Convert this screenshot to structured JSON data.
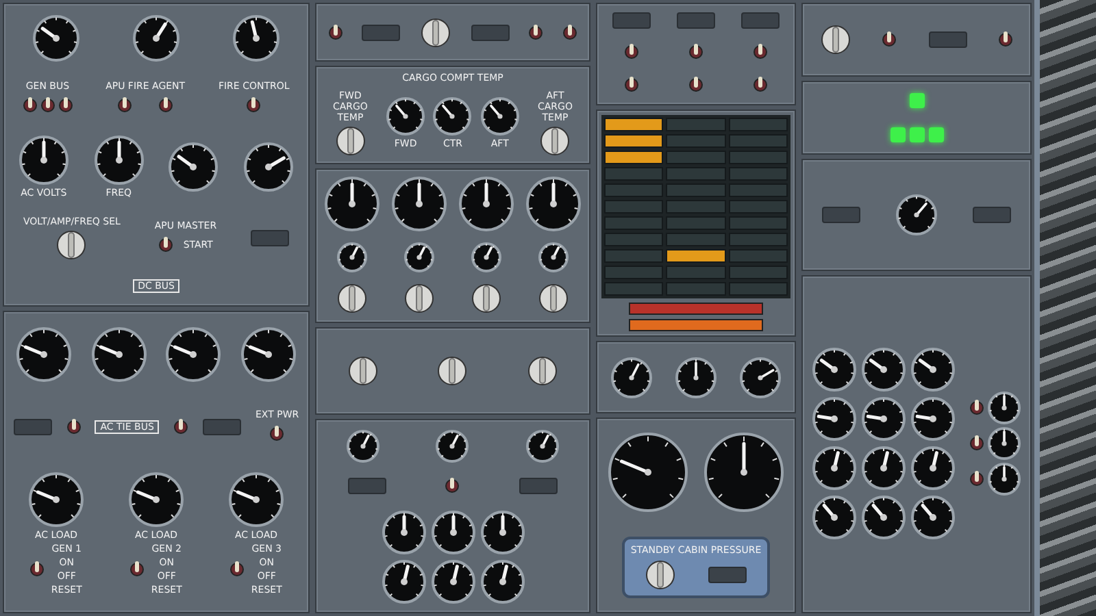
{
  "left_upper": {
    "top_gauges": [
      {
        "level": 0.3
      },
      {
        "level": 0.62
      },
      {
        "level": 0.45
      }
    ],
    "gen_bus": "GEN BUS",
    "apu_fire": "APU FIRE AGENT",
    "fire_control": "FIRE CONTROL",
    "meters": [
      {
        "label": "AC VOLTS",
        "level": 0.5
      },
      {
        "label": "FREQ",
        "level": 0.5
      },
      {
        "level": 0.3
      },
      {
        "level": 0.72
      }
    ],
    "selector": "VOLT/AMP/FREQ SEL",
    "apu_master": "APU MASTER",
    "apu_start": "START",
    "bus": "DC BUS"
  },
  "left_lower": {
    "load_gauges": [
      {
        "level": 0.25
      },
      {
        "level": 0.25
      },
      {
        "level": 0.25
      },
      {
        "level": 0.25
      }
    ],
    "tie_bus": "AC TIE BUS",
    "ext_pwr": "EXT PWR",
    "generators": [
      {
        "name": "GEN 1",
        "positions": [
          "ON",
          "OFF",
          "RESET"
        ],
        "gauge": {
          "label": "AC LOAD",
          "level": 0.25
        }
      },
      {
        "name": "GEN 2",
        "positions": [
          "ON",
          "OFF",
          "RESET"
        ],
        "gauge": {
          "label": "AC LOAD",
          "level": 0.25
        }
      },
      {
        "name": "GEN 3",
        "positions": [
          "ON",
          "OFF",
          "RESET"
        ],
        "gauge": {
          "label": "AC LOAD",
          "level": 0.25
        }
      }
    ]
  },
  "middle_upper": {
    "title": "CARGO COMPT TEMP",
    "fwd_selector": "FWD CARGO TEMP",
    "aft_selector": "AFT CARGO TEMP",
    "temps": [
      {
        "label": "FWD",
        "level": 0.35
      },
      {
        "label": "CTR",
        "level": 0.35
      },
      {
        "label": "AFT",
        "level": 0.35
      }
    ],
    "big_gauges": [
      {
        "level": 0.5
      },
      {
        "level": 0.5
      },
      {
        "level": 0.5
      },
      {
        "level": 0.5
      }
    ],
    "small_gauges": [
      {
        "level": 0.6
      },
      {
        "level": 0.6
      },
      {
        "level": 0.6
      },
      {
        "level": 0.6
      }
    ]
  },
  "middle_lower": {
    "small_gauges": [
      {
        "level": 0.6
      },
      {
        "level": 0.6
      },
      {
        "level": 0.6
      }
    ],
    "engine_gauges": [
      {
        "level": 0.5
      },
      {
        "level": 0.5
      },
      {
        "level": 0.5
      },
      {
        "level": 0.55
      },
      {
        "level": 0.55
      },
      {
        "level": 0.55
      }
    ]
  },
  "annunciators": {
    "rows": [
      {
        "cells": [
          true,
          false,
          false
        ]
      },
      {
        "cells": [
          true,
          false,
          false
        ]
      },
      {
        "cells": [
          true,
          false,
          false
        ]
      },
      {
        "cells": [
          false,
          false,
          false
        ]
      },
      {
        "cells": [
          false,
          false,
          false
        ]
      },
      {
        "cells": [
          false,
          false,
          false
        ]
      },
      {
        "cells": [
          false,
          false,
          false
        ]
      },
      {
        "cells": [
          false,
          false,
          false
        ]
      },
      {
        "cells": [
          false,
          true,
          false
        ]
      },
      {
        "cells": [
          false,
          false,
          false
        ]
      },
      {
        "cells": [
          false,
          false,
          false
        ]
      }
    ],
    "warnings": [
      {
        "color": "#b8322a"
      },
      {
        "color": "#e06a1e"
      }
    ],
    "gauges": [
      {
        "level": 0.6
      },
      {
        "level": 0.5
      },
      {
        "level": 0.72
      }
    ]
  },
  "standby": {
    "title": "STANDBY CABIN PRESSURE",
    "instruments": [
      {
        "level": 0.25
      },
      {
        "level": 0.5
      }
    ]
  },
  "right": {
    "green_lights": [
      {
        "on": true
      },
      {
        "on": true
      },
      {
        "on": true
      },
      {
        "on": true
      }
    ],
    "clock": {
      "level": 0.65
    },
    "gauge_grid": [
      {
        "level": 0.3
      },
      {
        "level": 0.3
      },
      {
        "level": 0.3
      },
      {
        "level": 0.2
      },
      {
        "level": 0.2
      },
      {
        "level": 0.2
      },
      {
        "level": 0.55
      },
      {
        "level": 0.55
      },
      {
        "level": 0.55
      },
      {
        "level": 0.35
      },
      {
        "level": 0.35
      },
      {
        "level": 0.35
      }
    ],
    "side_gauges": [
      {
        "level": 0.5
      },
      {
        "level": 0.5
      },
      {
        "level": 0.5
      }
    ]
  }
}
